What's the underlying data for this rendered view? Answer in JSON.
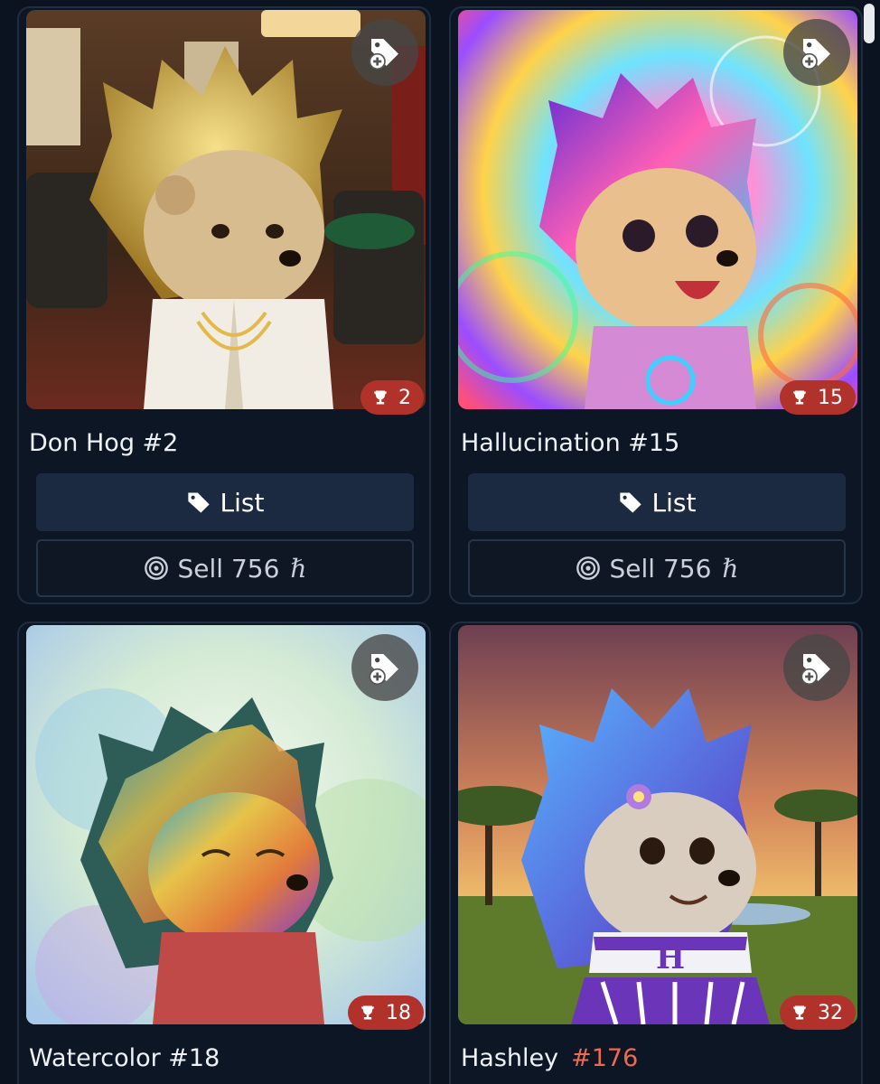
{
  "cards": [
    {
      "name": "Don Hog #2",
      "trophy_count": "2",
      "list_label": "List",
      "sell_label": "Sell 756",
      "currency_symbol": "ℏ"
    },
    {
      "name": "Hallucination #15",
      "trophy_count": "15",
      "list_label": "List",
      "sell_label": "Sell 756",
      "currency_symbol": "ℏ"
    },
    {
      "name": "Watercolor #18",
      "trophy_count": "18"
    },
    {
      "name": "Hashley",
      "number": "#176",
      "trophy_count": "32"
    }
  ],
  "icons": {
    "tag_add": "tag-plus-icon",
    "trophy": "trophy-icon",
    "tag": "tag-icon",
    "target": "target-icon"
  },
  "colors": {
    "background": "#0b1320",
    "badge": "#b0322b",
    "list_button": "#1c2a41",
    "accent_number": "#ef6a4e"
  }
}
